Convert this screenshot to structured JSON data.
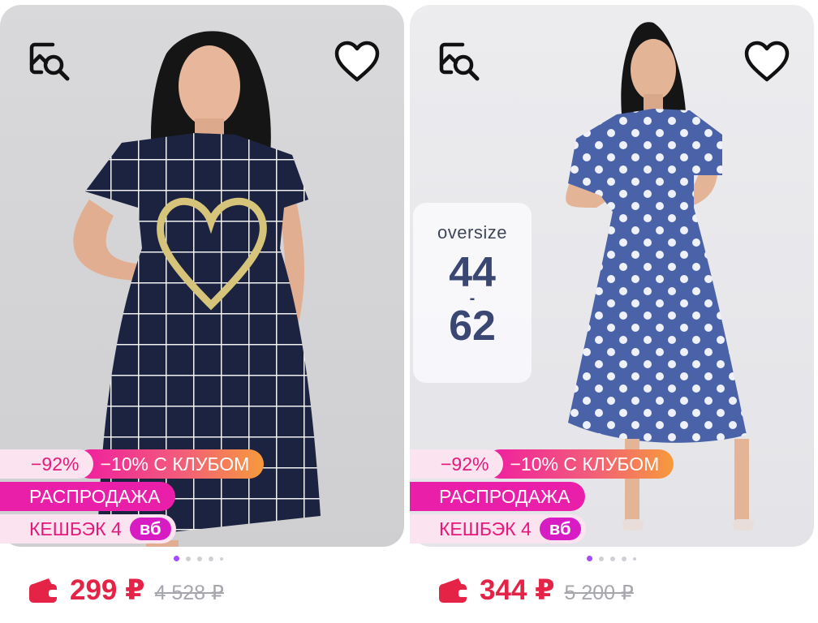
{
  "products": [
    {
      "discount": "−92%",
      "club_discount": "−10% С КЛУБОМ",
      "sale_label": "РАСПРОДАЖА",
      "cashback_label": "КЕШБЭК 4",
      "cashback_currency": "вб",
      "price": "299 ₽",
      "old_price": "4 528 ₽",
      "dress_color": "#1b2340",
      "pattern": "white grid with gold heart",
      "carousel": {
        "total": 5,
        "active": 1
      }
    },
    {
      "size_badge": {
        "label": "oversize",
        "from": "44",
        "separator": "-",
        "to": "62"
      },
      "discount": "−92%",
      "club_discount": "−10% С КЛУБОМ",
      "sale_label": "РАСПРОДАЖА",
      "cashback_label": "КЕШБЭК 4",
      "cashback_currency": "вб",
      "price": "344 ₽",
      "old_price": "5 200 ₽",
      "dress_color": "#4a62a7",
      "pattern": "white polka dots",
      "carousel": {
        "total": 5,
        "active": 1
      }
    }
  ],
  "icons": {
    "search": "image-search-icon",
    "favorite": "heart-outline-icon",
    "wallet": "wallet-icon"
  },
  "colors": {
    "accent_pink": "#e6197b",
    "sale_magenta": "#ea1fa9",
    "price_red": "#e52346",
    "old_price_gray": "#a6a6ad",
    "carousel_active": "#a64cff"
  }
}
